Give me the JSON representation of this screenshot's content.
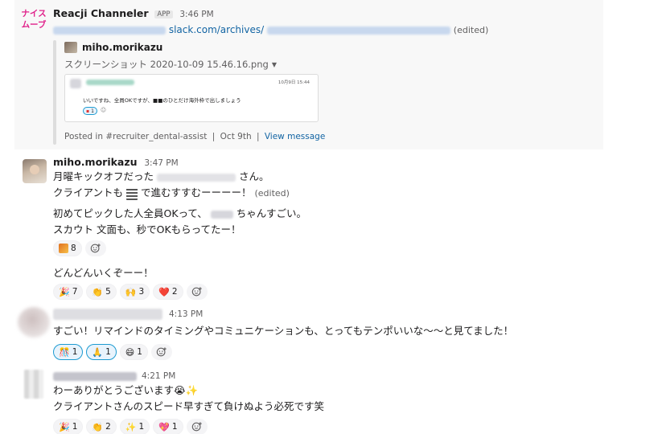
{
  "msg1": {
    "avatar_text": "ナイス\nムーブ",
    "sender": "Reacji Channeler",
    "badge": "APP",
    "time": "3:46 PM",
    "link_text": "slack.com/archives/",
    "edited": "(edited)",
    "quote": {
      "author": "miho.morikazu",
      "file": "スクリーンショット 2020-10-09 15.46.16.png",
      "thumb_time": "10月9日 15:44",
      "thumb_text": "いいですね、全員OKですが、■■のひとだけ海外枠で出しましょう",
      "thumb_rx_count": "1",
      "posted_in": "Posted in #recruiter_dental-assist",
      "date": "Oct 9th",
      "view": "View message"
    }
  },
  "msg2": {
    "sender": "miho.morikazu",
    "time": "3:47 PM",
    "line1_a": "月曜キックオフだった",
    "line1_b": "さん。",
    "line2_a": "クライアントも",
    "line2_b": "で進むすすむーーーー！",
    "edited": "(edited)",
    "line3_a": "初めてピックした人全員OKって、",
    "line3_b": "ちゃんすごい。",
    "line4": "スカウト 文面も、秒でOKもらってたー！",
    "rx1_count": "8",
    "line5": "どんどんいくぞーー！",
    "rx2": [
      {
        "emoji": "🎉",
        "count": "7"
      },
      {
        "emoji": "👏",
        "count": "5"
      },
      {
        "emoji": "🙌",
        "count": "3"
      },
      {
        "emoji": "❤️",
        "count": "2"
      }
    ]
  },
  "msg3": {
    "time": "4:13 PM",
    "text": "すごい！リマインドのタイミングやコミュニケーションも、とってもテンポいいな〜〜と見てました！",
    "rx": [
      {
        "emoji": "🎊",
        "count": "1"
      },
      {
        "emoji": "🙏",
        "count": "1"
      },
      {
        "emoji": "😄",
        "count": "1"
      }
    ]
  },
  "msg4": {
    "time": "4:21 PM",
    "line1": "わーありがとうございます😭✨",
    "line2": "クライアントさんのスピード早すぎて負けぬよう必死です笑",
    "rx": [
      {
        "emoji": "🎉",
        "count": "1"
      },
      {
        "emoji": "👏",
        "count": "2"
      },
      {
        "emoji": "✨",
        "count": "1"
      },
      {
        "emoji": "💖",
        "count": "1"
      }
    ]
  },
  "colors": {
    "link": "#1264a3",
    "avatar_pink": "#e0218a",
    "highlight": "#f8f8f8"
  }
}
